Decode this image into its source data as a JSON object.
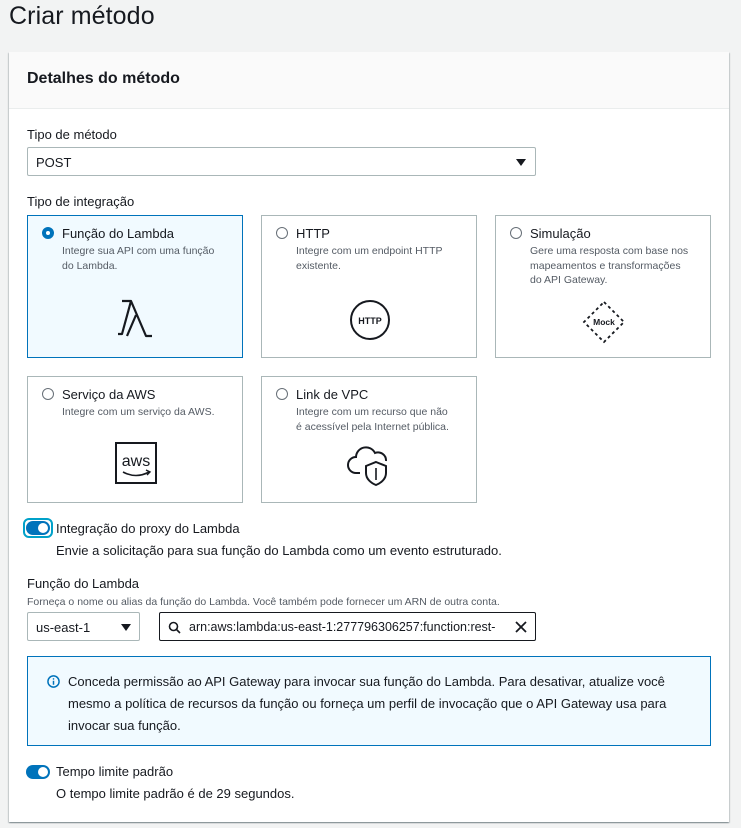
{
  "page": {
    "title": "Criar método"
  },
  "card": {
    "title": "Detalhes do método"
  },
  "method_type": {
    "label": "Tipo de método",
    "value": "POST"
  },
  "integration_type": {
    "label": "Tipo de integração",
    "options": [
      {
        "title": "Função do Lambda",
        "desc1": "Integre sua API com uma função",
        "desc2": "do Lambda.",
        "icon": "lambda-icon",
        "selected": true
      },
      {
        "title": "HTTP",
        "desc1": "Integre com um endpoint HTTP",
        "desc2": "existente.",
        "icon": "http-icon",
        "icon_text": "HTTP",
        "selected": false
      },
      {
        "title": "Simulação",
        "desc1": "Gere uma resposta com base nos",
        "desc2": "mapeamentos e transformações",
        "desc3": "do API Gateway.",
        "icon": "mock-icon",
        "icon_text": "Mock",
        "selected": false
      },
      {
        "title": "Serviço da AWS",
        "desc1": "Integre com um serviço da AWS.",
        "icon": "aws-icon",
        "icon_text": "aws",
        "selected": false
      },
      {
        "title": "Link de VPC",
        "desc1": "Integre com um recurso que não",
        "desc2": "é acessível pela Internet pública.",
        "icon": "vpc-link-icon",
        "selected": false
      }
    ]
  },
  "lambda_proxy": {
    "label": "Integração do proxy do Lambda",
    "description": "Envie a solicitação para sua função do Lambda como um evento estruturado.",
    "enabled": true
  },
  "lambda_function": {
    "label": "Função do Lambda",
    "hint": "Forneça o nome ou alias da função do Lambda. Você também pode fornecer um ARN de outra conta.",
    "region": "us-east-1",
    "arn_value": "arn:aws:lambda:us-east-1:277796306257:function:rest-"
  },
  "info": {
    "text": "Conceda permissão ao API Gateway para invocar sua função do Lambda. Para desativar, atualize você mesmo a política de recursos da função ou forneça um perfil de invocação que o API Gateway usa para invocar sua função."
  },
  "default_timeout": {
    "label": "Tempo limite padrão",
    "description": "O tempo limite padrão é de 29 segundos.",
    "enabled": true
  },
  "colors": {
    "accent": "#0073bb",
    "selected_bg": "#f1faff",
    "border": "#aab7b8",
    "text": "#16191f"
  }
}
